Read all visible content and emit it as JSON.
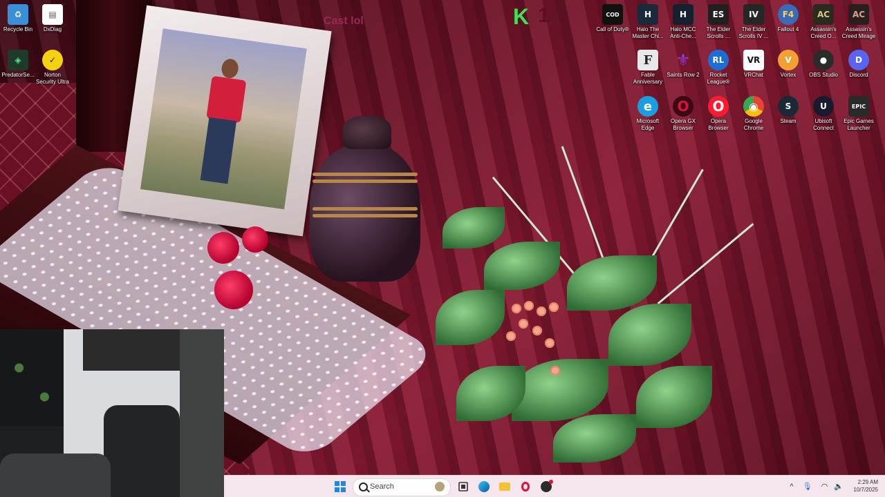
{
  "wallpaper": {
    "overlay_text": "Cast lol",
    "logo_letter": "K",
    "logo_number": "1"
  },
  "desktop_icons": {
    "left_column": [
      {
        "label": "Recycle Bin",
        "icon": "recycle-bin-icon",
        "color": "#3b8fd6"
      },
      {
        "label": "DxDiag",
        "icon": "document-icon",
        "color": "#ffffff"
      },
      {
        "label": "PredatorSe...",
        "icon": "predator-icon",
        "color": "#1f3a2a"
      },
      {
        "label": "Norton Security Ultra",
        "icon": "norton-icon",
        "color": "#f5d20f"
      }
    ],
    "right_row1": [
      {
        "label": "Call of Duty®",
        "icon": "call-of-duty-icon",
        "color": "#111111",
        "glyph": "COD"
      },
      {
        "label": "Halo The Master Chi...",
        "icon": "halo-icon",
        "color": "#1a2a3a",
        "glyph": "H"
      },
      {
        "label": "Halo MCC Anti-Che...",
        "icon": "halo-mcc-icon",
        "color": "#14202d",
        "glyph": "H"
      },
      {
        "label": "The Elder Scrolls ...",
        "icon": "elder-scrolls-icon",
        "color": "#202020",
        "glyph": "ES"
      },
      {
        "label": "The Elder Scrolls IV ...",
        "icon": "oblivion-icon",
        "color": "#262626",
        "glyph": "IV"
      },
      {
        "label": "Fallout 4",
        "icon": "fallout-vault-boy-icon",
        "color": "#3a6ab8",
        "glyph": "F4"
      },
      {
        "label": "Assassin's Creed O...",
        "icon": "assassins-creed-icon",
        "color": "#2a2a1e",
        "glyph": "AC"
      },
      {
        "label": "Assassin's Creed Mirage",
        "icon": "assassins-creed-mirage-icon",
        "color": "#2a1e1e",
        "glyph": "AC"
      }
    ],
    "right_row2": [
      {
        "label": "Fable Anniversary",
        "icon": "fable-icon",
        "color": "#e8e8e8",
        "glyph": "F"
      },
      {
        "label": "Saints Row 2",
        "icon": "saints-row-icon",
        "color": "#6a2bb0",
        "glyph": "⚜"
      },
      {
        "label": "Rocket League®",
        "icon": "rocket-league-icon",
        "color": "#1b6ed6",
        "glyph": "RL"
      },
      {
        "label": "VRChat",
        "icon": "vrchat-icon",
        "color": "#ffffff",
        "glyph": "VR"
      },
      {
        "label": "Vortex",
        "icon": "vortex-icon",
        "color": "#f2a033",
        "glyph": "V"
      },
      {
        "label": "OBS Studio",
        "icon": "obs-icon",
        "color": "#2b2b2b",
        "glyph": "●"
      },
      {
        "label": "Discord",
        "icon": "discord-icon",
        "color": "#5865f2",
        "glyph": "D"
      }
    ],
    "right_row3": [
      {
        "label": "Microsoft Edge",
        "icon": "edge-icon",
        "color": "#1b9de2",
        "glyph": "e"
      },
      {
        "label": "Opera GX Browser",
        "icon": "opera-gx-icon",
        "color": "#e0103a",
        "glyph": "O"
      },
      {
        "label": "Opera Browser",
        "icon": "opera-icon",
        "color": "#ff1b2d",
        "glyph": "O"
      },
      {
        "label": "Google Chrome",
        "icon": "chrome-icon",
        "color": "#4285f4",
        "glyph": "◉"
      },
      {
        "label": "Steam",
        "icon": "steam-icon",
        "color": "#1b2838",
        "glyph": "S"
      },
      {
        "label": "Ubisoft Connect",
        "icon": "ubisoft-icon",
        "color": "#1a1a2e",
        "glyph": "U"
      },
      {
        "label": "Epic Games Launcher",
        "icon": "epic-games-icon",
        "color": "#2a2a2a",
        "glyph": "EPIC"
      }
    ]
  },
  "taskbar": {
    "search_placeholder": "Search",
    "apps": [
      {
        "name": "start-button",
        "icon": "windows-start-icon",
        "color": "#1e88e5"
      },
      {
        "name": "task-view-button",
        "icon": "task-view-icon",
        "color": "#333333"
      },
      {
        "name": "edge-taskbar-button",
        "icon": "edge-icon",
        "color": "#1b9de2"
      },
      {
        "name": "file-explorer-taskbar-button",
        "icon": "folder-icon",
        "color": "#f2c232"
      },
      {
        "name": "opera-gx-taskbar-button",
        "icon": "opera-gx-icon",
        "color": "#e0103a"
      },
      {
        "name": "obs-taskbar-button",
        "icon": "obs-icon",
        "color": "#2b2b2b"
      }
    ],
    "clock": {
      "time": "2:29 AM",
      "date": "10/7/2025"
    }
  }
}
